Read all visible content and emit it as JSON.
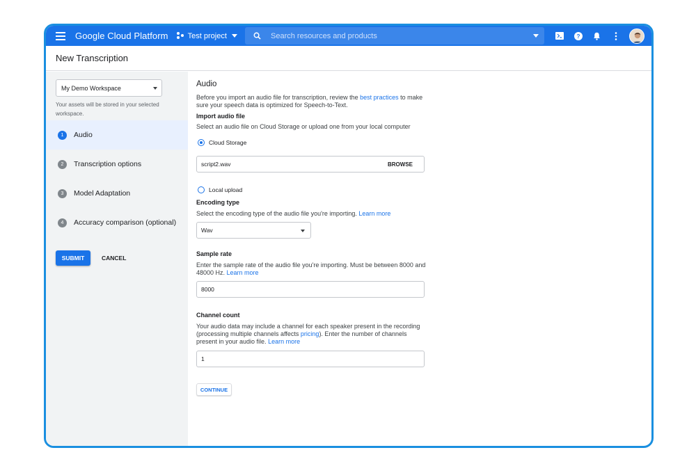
{
  "topbar": {
    "brand": "Google Cloud Platform",
    "project": "Test project",
    "search_placeholder": "Search resources and products",
    "icons": [
      "terminal-icon",
      "help-icon",
      "bell-icon",
      "more-vert-icon",
      "avatar"
    ]
  },
  "page": {
    "title": "New Transcription"
  },
  "sidebar": {
    "workspace_value": "My Demo Workspace",
    "workspace_note": "Your assets will be stored in your selected workspace.",
    "steps": [
      {
        "num": "1",
        "label": "Audio",
        "active": true
      },
      {
        "num": "2",
        "label": "Transcription options"
      },
      {
        "num": "3",
        "label": "Model Adaptation"
      },
      {
        "num": "4",
        "label": "Accuracy comparison (optional)"
      }
    ],
    "submit_label": "SUBMIT",
    "cancel_label": "CANCEL"
  },
  "audio": {
    "title": "Audio",
    "intro_pre": "Before you import an audio file for transcription, review the ",
    "intro_link": "best practices",
    "intro_post": " to make sure your speech data is optimized for Speech-to-Text.",
    "import_label": "Import audio file",
    "import_desc": "Select an audio file on Cloud Storage or upload one from your local computer",
    "radio_cloud": "Cloud Storage",
    "file_value": "script2.wav",
    "browse_label": "BROWSE",
    "radio_local": "Local upload",
    "encoding_label": "Encoding type",
    "encoding_desc": "Select the encoding type of the audio file you're importing. ",
    "encoding_link": "Learn more",
    "encoding_value": "Wav",
    "sample_label": "Sample rate",
    "sample_desc": "Enter the sample rate of the audio file you're importing. Must be between 8000 and 48000 Hz. ",
    "sample_link": "Learn more",
    "sample_value": "8000",
    "channel_label": "Channel count",
    "channel_desc_pre": "Your audio data may include a channel for each speaker present in the recording (processing multiple channels affects ",
    "channel_pricing": "pricing",
    "channel_desc_post": "). Enter the number of channels present in your audio file. ",
    "channel_link": "Learn more",
    "channel_value": "1",
    "continue_label": "CONTINUE"
  },
  "colors": {
    "accent": "#1a73e8",
    "frame": "#1a8fe0",
    "sidebar_bg": "#f1f3f4",
    "active_step_bg": "#e8f0fe"
  }
}
